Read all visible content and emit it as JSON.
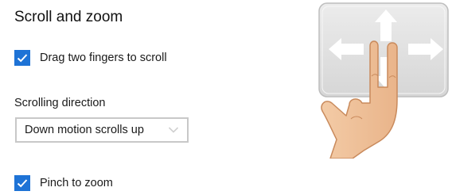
{
  "section": {
    "title": "Scroll and zoom"
  },
  "scroll": {
    "label": "Drag two fingers to scroll",
    "checked": true
  },
  "direction": {
    "label": "Scrolling direction",
    "value": "Down motion scrolls up"
  },
  "zoom": {
    "label": "Pinch to zoom",
    "checked": true
  },
  "colors": {
    "accent": "#1e73d6",
    "touchpad": "#e4e4e4"
  },
  "icons": {
    "checkbox": "checkmark-icon",
    "dropdown": "chevron-down-icon",
    "illustration": "two-finger-touchpad-icon"
  }
}
